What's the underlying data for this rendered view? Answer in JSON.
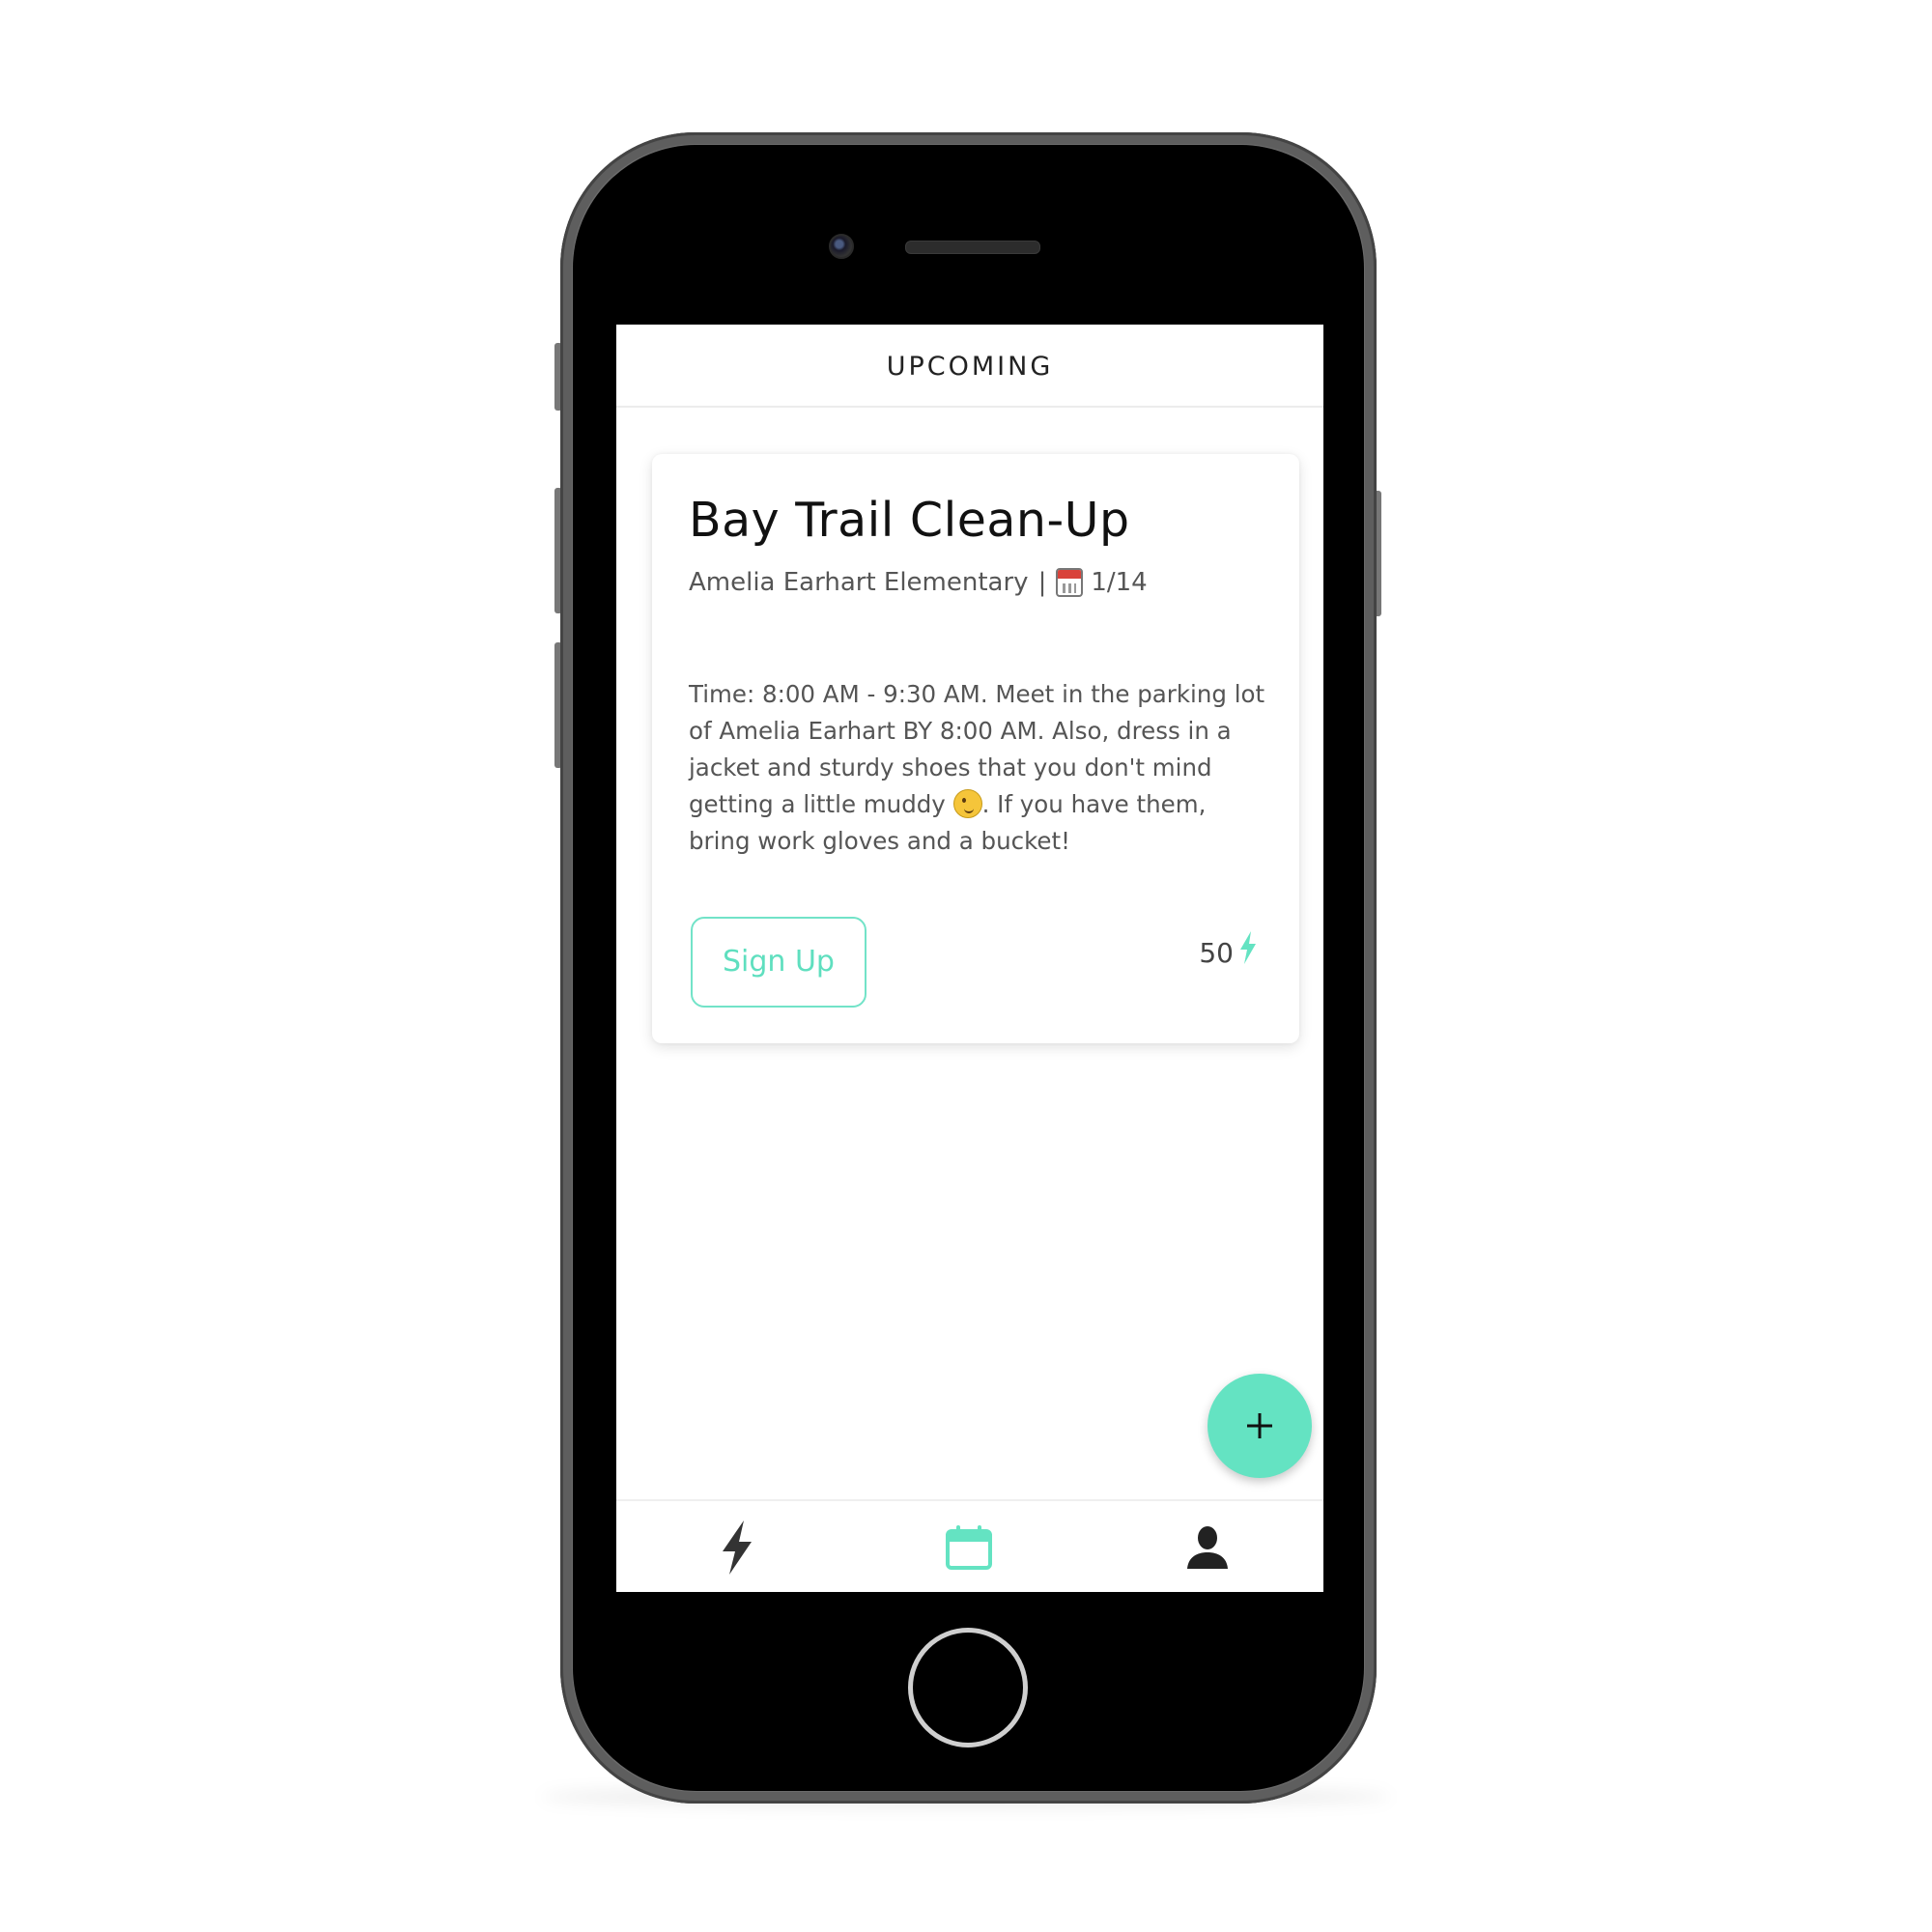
{
  "header": {
    "title": "UPCOMING"
  },
  "event_card": {
    "title": "Bay Trail Clean-Up",
    "organizer": "Amelia Earhart Elementary",
    "separator": "|",
    "date_icon": "calendar-emoji-icon",
    "date": "1/14",
    "description_part1": "Time: 8:00 AM - 9:30 AM. Meet in the parking lot of Amelia Earhart BY 8:00 AM. Also, dress in a jacket and sturdy shoes that you don't mind getting a little muddy ",
    "description_emoji": "winking-face-emoji-icon",
    "description_part2": ". If you have them, bring work gloves and a bucket!",
    "signup_label": "Sign Up",
    "points": "50",
    "points_icon": "lightning-bolt-icon"
  },
  "fab": {
    "icon": "plus-icon"
  },
  "tabbar": {
    "tabs": [
      {
        "icon": "lightning-bolt-icon",
        "active": false
      },
      {
        "icon": "calendar-icon",
        "active": true
      },
      {
        "icon": "user-icon",
        "active": false
      }
    ]
  },
  "colors": {
    "accent": "#64e3c2",
    "accent_text": "#5fdfbf",
    "text_dark": "#111111",
    "text_muted": "#555555"
  }
}
